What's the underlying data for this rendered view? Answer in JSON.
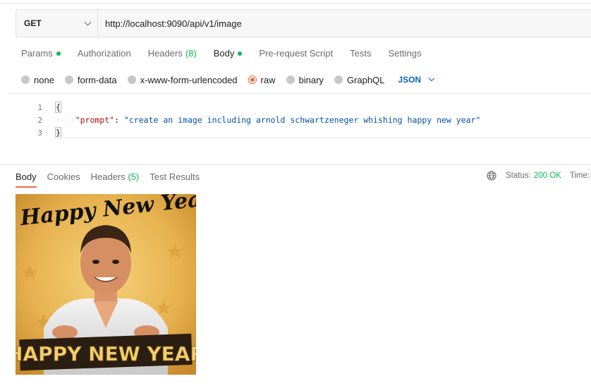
{
  "request": {
    "method": "GET",
    "url": "http://localhost:9090/api/v1/image"
  },
  "request_tabs": [
    {
      "label": "Params",
      "count": "",
      "dot": true
    },
    {
      "label": "Authorization",
      "count": "",
      "dot": false
    },
    {
      "label": "Headers",
      "count": "(8)",
      "dot": false
    },
    {
      "label": "Body",
      "count": "",
      "dot": true
    },
    {
      "label": "Pre-request Script",
      "count": "",
      "dot": false
    },
    {
      "label": "Tests",
      "count": "",
      "dot": false
    },
    {
      "label": "Settings",
      "count": "",
      "dot": false
    }
  ],
  "body_types": {
    "none": "none",
    "form_data": "form-data",
    "urlencoded": "x-www-form-urlencoded",
    "raw": "raw",
    "binary": "binary",
    "graphql": "GraphQL",
    "selected": "raw",
    "format": "JSON"
  },
  "editor": {
    "line_numbers": [
      "1",
      "2",
      "3"
    ],
    "open_brace": "{",
    "close_brace": "}",
    "key": "\"prompt\"",
    "colon": ": ",
    "value": "\"create an image including arnold schwartzeneger whishing happy new year\""
  },
  "response_tabs": [
    {
      "label": "Body",
      "count": ""
    },
    {
      "label": "Cookies",
      "count": ""
    },
    {
      "label": "Headers",
      "count": "(5)"
    },
    {
      "label": "Test Results",
      "count": ""
    }
  ],
  "response_status": {
    "label": "Status:",
    "code": "200 OK",
    "time_label": "Time:"
  },
  "response_image": {
    "top_text": "Happy New Year!",
    "bottom_text": "HAPPY NEW YEAR"
  },
  "colors": {
    "accent": "#f26b3a",
    "success": "#0cbb52",
    "link": "#0b63c3"
  }
}
